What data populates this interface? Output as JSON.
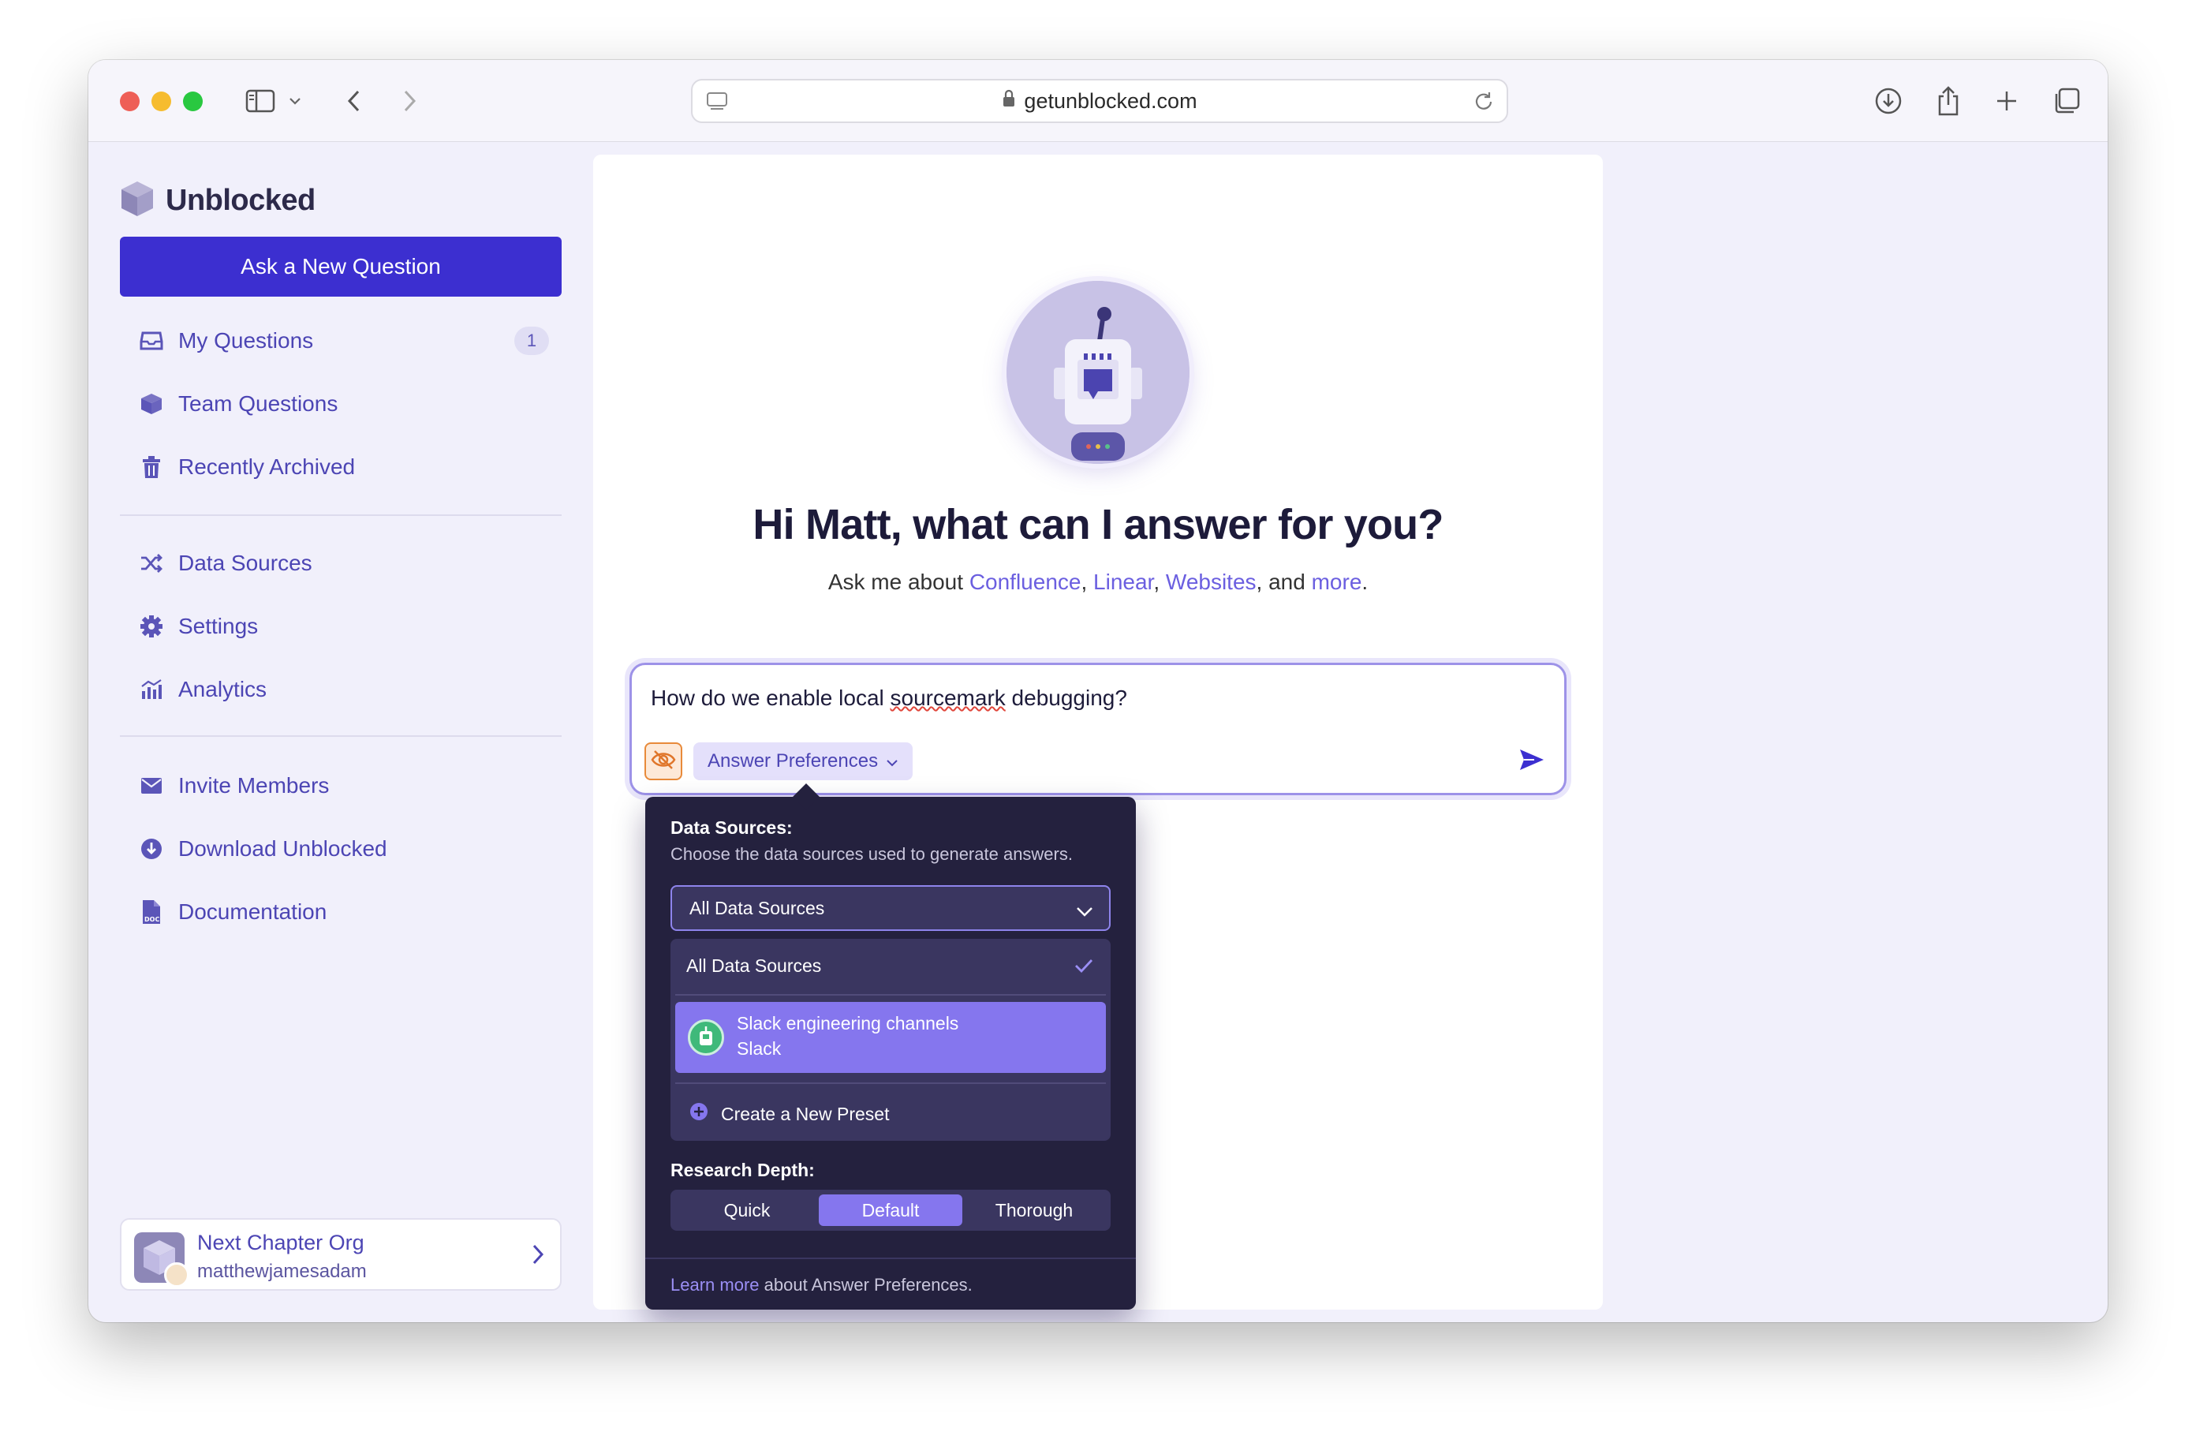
{
  "browser": {
    "url": "getunblocked.com"
  },
  "sidebar": {
    "brand": "Unblocked",
    "ask_button": "Ask a New Question",
    "items": [
      {
        "label": "My Questions",
        "icon": "inbox-icon",
        "badge": "1"
      },
      {
        "label": "Team Questions",
        "icon": "cube-icon"
      },
      {
        "label": "Recently Archived",
        "icon": "trash-icon"
      },
      {
        "label": "Data Sources",
        "icon": "shuffle-icon"
      },
      {
        "label": "Settings",
        "icon": "gear-icon"
      },
      {
        "label": "Analytics",
        "icon": "chart-icon"
      },
      {
        "label": "Invite Members",
        "icon": "mail-icon"
      },
      {
        "label": "Download Unblocked",
        "icon": "download-icon"
      },
      {
        "label": "Documentation",
        "icon": "doc-icon"
      }
    ],
    "org": {
      "name": "Next Chapter Org",
      "user": "matthewjamesadam"
    }
  },
  "main": {
    "greeting": "Hi Matt, what can I answer for you?",
    "sub_prefix": "Ask me about ",
    "sub_links": [
      "Confluence",
      "Linear",
      "Websites",
      "more"
    ],
    "sub_sep1": ", ",
    "sub_sep2": ", ",
    "sub_and": ", and ",
    "sub_end": ".",
    "question_pre": "How do we enable local ",
    "question_spell": "sourcemark",
    "question_post": " debugging?",
    "pref_button": "Answer Preferences"
  },
  "popover": {
    "ds_heading": "Data Sources:",
    "ds_desc": "Choose the data sources used to generate answers.",
    "selected": "All Data Sources",
    "options": {
      "all": "All Data Sources",
      "slack_title": "Slack engineering channels",
      "slack_sub": "Slack",
      "new_preset": "Create a New Preset"
    },
    "depth_heading": "Research Depth:",
    "depth_options": [
      "Quick",
      "Default",
      "Thorough"
    ],
    "depth_active": "Default",
    "footer_link": "Learn more",
    "footer_text": " about Answer Preferences."
  },
  "colors": {
    "accent": "#3c2fd0",
    "link": "#6b5fe0",
    "nav_text": "#4c45b4",
    "popover_bg": "#24213e",
    "selected_option": "#8576ee"
  }
}
